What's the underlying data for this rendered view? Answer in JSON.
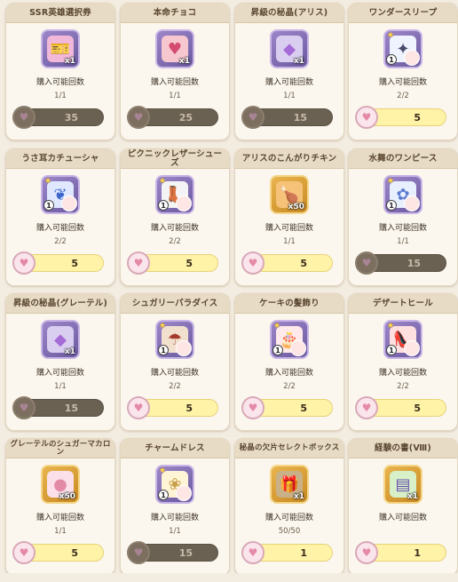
{
  "purchase_label": "購入可能回数",
  "currency_icon": "heart-coin-icon",
  "items": [
    {
      "name": "SSR英雄選択券",
      "qty": "x1",
      "count": "1/1",
      "price": "35",
      "sold_out": true,
      "icon": "ticket-icon",
      "one_badge": false
    },
    {
      "name": "本命チョコ",
      "qty": "x1",
      "count": "1/1",
      "price": "25",
      "sold_out": true,
      "icon": "chocolate-heart-icon",
      "one_badge": false
    },
    {
      "name": "昇級の秘晶(アリス)",
      "qty": "x1",
      "count": "1/1",
      "price": "15",
      "sold_out": true,
      "icon": "crystal-icon",
      "one_badge": false
    },
    {
      "name": "ワンダースリープ",
      "qty": "",
      "count": "2/2",
      "price": "5",
      "sold_out": false,
      "icon": "costume-icon",
      "one_badge": true
    },
    {
      "name": "うさ耳カチューシャ",
      "qty": "",
      "count": "2/2",
      "price": "5",
      "sold_out": false,
      "icon": "bunny-ears-icon",
      "one_badge": true
    },
    {
      "name": "ピクニックレザーシューズ",
      "qty": "",
      "count": "2/2",
      "price": "5",
      "sold_out": false,
      "icon": "shoes-icon",
      "one_badge": true
    },
    {
      "name": "アリスのこんがりチキン",
      "qty": "x50",
      "count": "1/1",
      "price": "5",
      "sold_out": false,
      "icon": "chicken-icon",
      "one_badge": false
    },
    {
      "name": "水舞のワンピース",
      "qty": "",
      "count": "1/1",
      "price": "15",
      "sold_out": true,
      "icon": "dress-icon",
      "one_badge": true
    },
    {
      "name": "昇級の秘晶(グレーテル)",
      "qty": "x1",
      "count": "1/1",
      "price": "15",
      "sold_out": true,
      "icon": "crystal-icon",
      "one_badge": false
    },
    {
      "name": "シュガリーパラダイス",
      "qty": "",
      "count": "2/2",
      "price": "5",
      "sold_out": false,
      "icon": "parasol-icon",
      "one_badge": true
    },
    {
      "name": "ケーキの髪飾り",
      "qty": "",
      "count": "2/2",
      "price": "5",
      "sold_out": false,
      "icon": "cake-hairpin-icon",
      "one_badge": true
    },
    {
      "name": "デザートヒール",
      "qty": "",
      "count": "2/2",
      "price": "5",
      "sold_out": false,
      "icon": "heels-icon",
      "one_badge": true
    },
    {
      "name": "グレーテルのシュガーマカロン",
      "qty": "x50",
      "count": "1/1",
      "price": "5",
      "sold_out": false,
      "icon": "macaron-icon",
      "one_badge": false
    },
    {
      "name": "チャームドレス",
      "qty": "",
      "count": "1/1",
      "price": "15",
      "sold_out": true,
      "icon": "charm-dress-icon",
      "one_badge": true
    },
    {
      "name": "秘晶の欠片セレクトボックス",
      "qty": "x1",
      "count": "50/50",
      "price": "1",
      "sold_out": false,
      "icon": "gift-box-icon",
      "one_badge": false
    },
    {
      "name": "経験の書(Ⅷ)",
      "qty": "x1",
      "count": "",
      "price": "1",
      "sold_out": false,
      "icon": "rainbow-book-icon",
      "one_badge": false
    }
  ]
}
